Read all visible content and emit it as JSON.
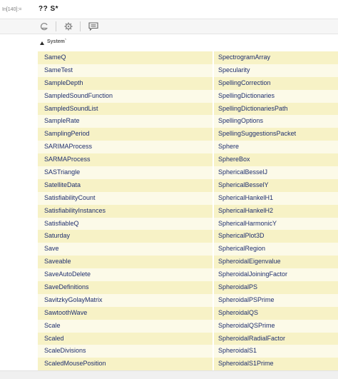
{
  "input": {
    "label": "In[140]:=",
    "text": "?? S*"
  },
  "header": {
    "context": "System`"
  },
  "rows": [
    [
      "SameQ",
      "SpectrogramArray"
    ],
    [
      "SameTest",
      "Specularity"
    ],
    [
      "SampleDepth",
      "SpellingCorrection"
    ],
    [
      "SampledSoundFunction",
      "SpellingDictionaries"
    ],
    [
      "SampledSoundList",
      "SpellingDictionariesPath"
    ],
    [
      "SampleRate",
      "SpellingOptions"
    ],
    [
      "SamplingPeriod",
      "SpellingSuggestionsPacket"
    ],
    [
      "SARIMAProcess",
      "Sphere"
    ],
    [
      "SARMAProcess",
      "SphereBox"
    ],
    [
      "SASTriangle",
      "SphericalBesselJ"
    ],
    [
      "SatelliteData",
      "SphericalBesselY"
    ],
    [
      "SatisfiabilityCount",
      "SphericalHankelH1"
    ],
    [
      "SatisfiabilityInstances",
      "SphericalHankelH2"
    ],
    [
      "SatisfiableQ",
      "SphericalHarmonicY"
    ],
    [
      "Saturday",
      "SphericalPlot3D"
    ],
    [
      "Save",
      "SphericalRegion"
    ],
    [
      "Saveable",
      "SpheroidalEigenvalue"
    ],
    [
      "SaveAutoDelete",
      "SpheroidalJoiningFactor"
    ],
    [
      "SaveDefinitions",
      "SpheroidalPS"
    ],
    [
      "SavitzkyGolayMatrix",
      "SpheroidalPSPrime"
    ],
    [
      "SawtoothWave",
      "SpheroidalQS"
    ],
    [
      "Scale",
      "SpheroidalQSPrime"
    ],
    [
      "Scaled",
      "SpheroidalRadialFactor"
    ],
    [
      "ScaleDivisions",
      "SpheroidalS1"
    ],
    [
      "ScaledMousePosition",
      "SpheroidalS1Prime"
    ]
  ],
  "icons": {
    "toolbar": [
      "evaluate-icon",
      "settings-gear-icon",
      "comment-icon"
    ],
    "header": "collapse-triangle-icon"
  },
  "colors": {
    "row_odd": "#f7f2c6",
    "row_even": "#fcfae8",
    "link_text": "#1f2f6e"
  }
}
